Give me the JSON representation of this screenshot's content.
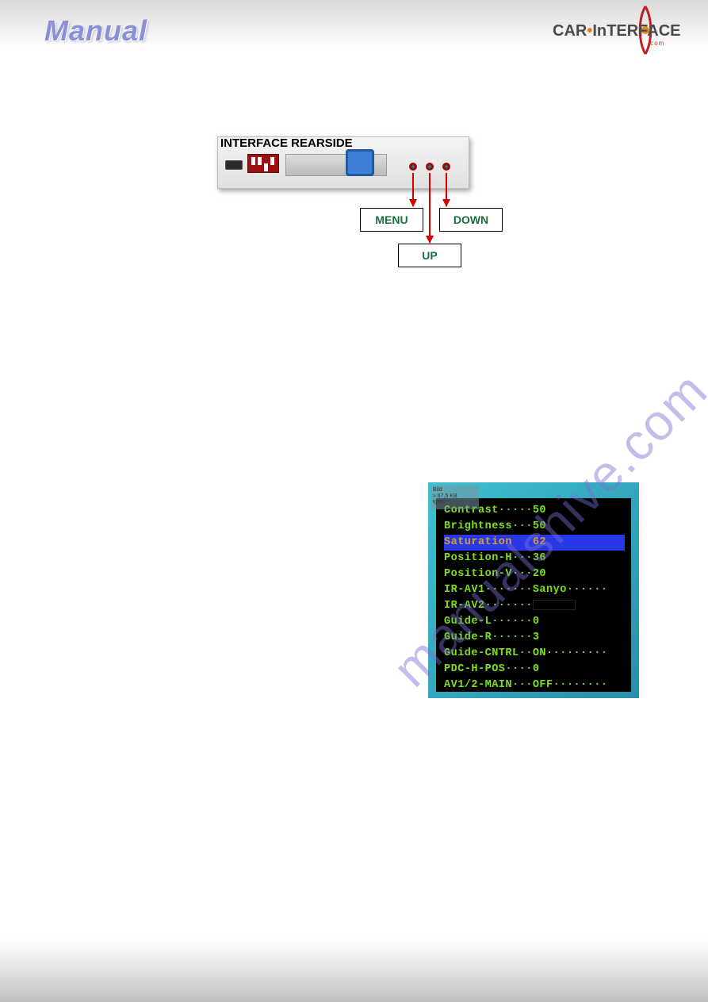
{
  "header": {
    "manual_text": "Manual",
    "brand_car": "CAR",
    "brand_dot": "•",
    "brand_interface": "InTERFACE",
    "brand_sub": ".com"
  },
  "device": {
    "label": "INTERFACE REARSIDE"
  },
  "buttons": {
    "menu": "MENU",
    "up": "UP",
    "down": "DOWN"
  },
  "osd_corner": {
    "l1": "Bild",
    "l2": "≈ 67,5 KB",
    "l3": "igen:"
  },
  "osd": {
    "rows": [
      {
        "text": "Contrast·····50",
        "hl": false
      },
      {
        "text": "Brightness···50",
        "hl": false
      },
      {
        "text": "Saturation   62",
        "hl": true
      },
      {
        "text": "Position-H···36",
        "hl": false
      },
      {
        "text": "Position-V···20",
        "hl": false
      },
      {
        "text": "IR-AV1·······Sanyo······",
        "hl": false
      },
      {
        "text": "IR-AV2·······",
        "hl": false,
        "blackbox": true
      },
      {
        "text": "Guide-L······0",
        "hl": false
      },
      {
        "text": "Guide-R······3",
        "hl": false
      },
      {
        "text": "Guide-CNTRL··ON·········",
        "hl": false
      },
      {
        "text": "PDC-H-POS····0",
        "hl": false
      },
      {
        "text": "AV1/2-MAIN···OFF········",
        "hl": false
      }
    ]
  },
  "watermark": "manualshive.com"
}
